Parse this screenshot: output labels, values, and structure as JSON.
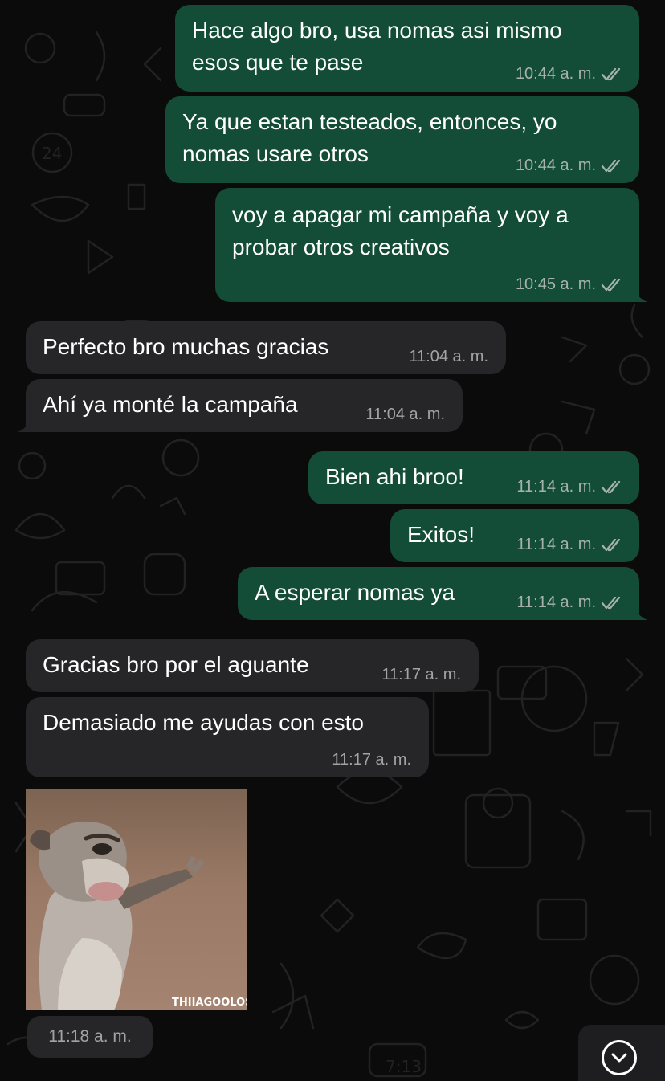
{
  "chat": {
    "messages": [
      {
        "direction": "outgoing",
        "lines": [
          "Hace algo bro, usa nomas asi mismo",
          "esos que te pase"
        ],
        "time": "10:44 a. m.",
        "read": true
      },
      {
        "direction": "outgoing",
        "lines": [
          "Ya que estan testeados, entonces, yo",
          "nomas usare otros"
        ],
        "time": "10:44 a. m.",
        "read": true
      },
      {
        "direction": "outgoing",
        "lines": [
          "voy a apagar mi campaña y voy a",
          "probar otros creativos"
        ],
        "time": "10:45 a. m.",
        "read": true
      },
      {
        "direction": "incoming",
        "lines": [
          "Perfecto bro muchas gracias"
        ],
        "time": "11:04 a. m."
      },
      {
        "direction": "incoming",
        "lines": [
          "Ahí ya monté la campaña"
        ],
        "time": "11:04 a. m."
      },
      {
        "direction": "outgoing",
        "lines": [
          "Bien ahi broo!"
        ],
        "time": "11:14 a. m.",
        "read": true
      },
      {
        "direction": "outgoing",
        "lines": [
          "Exitos!"
        ],
        "time": "11:14 a. m.",
        "read": true
      },
      {
        "direction": "outgoing",
        "lines": [
          "A esperar nomas ya"
        ],
        "time": "11:14 a. m.",
        "read": true
      },
      {
        "direction": "incoming",
        "lines": [
          "Gracias bro por el aguante"
        ],
        "time": "11:17 a. m."
      },
      {
        "direction": "incoming",
        "lines": [
          "Demasiado me ayudas con esto"
        ],
        "time": "11:17 a. m."
      }
    ],
    "sticker": {
      "watermark": "THIIAGOOLOST",
      "time": "11:18 a. m."
    },
    "scroll_button": {
      "icon": "chevron-down-icon"
    }
  },
  "colors": {
    "background": "#0b0b0b",
    "outgoing_bubble": "#144d37",
    "incoming_bubble": "#262628",
    "read_ticks": "#a6b3ac"
  }
}
